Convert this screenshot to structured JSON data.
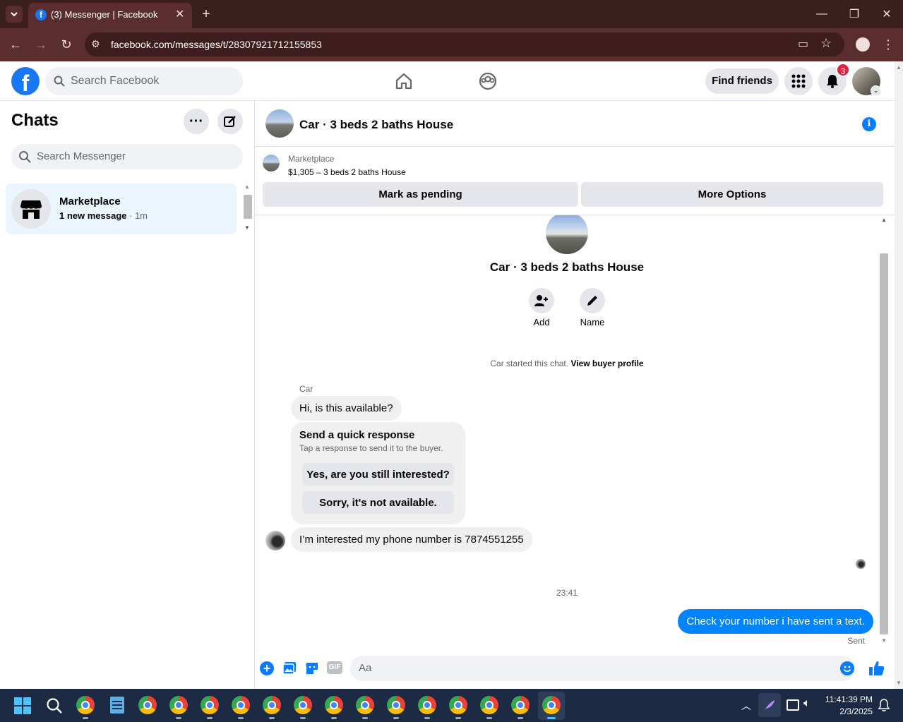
{
  "browser": {
    "tab_title": "(3) Messenger | Facebook",
    "url": "facebook.com/messages/t/28307921712155853",
    "colors": {
      "tabbar": "#3b1f1f",
      "toolbar": "#5a2e2e"
    }
  },
  "header": {
    "search_placeholder": "Search Facebook",
    "find_friends_label": "Find friends",
    "notification_count": "3"
  },
  "sidebar": {
    "title": "Chats",
    "search_placeholder": "Search Messenger",
    "chats": [
      {
        "name": "Marketplace",
        "preview": "1 new message",
        "time": "· 1m"
      }
    ]
  },
  "chat": {
    "title": "Car · 3 beds 2 baths House",
    "listing": {
      "source": "Marketplace",
      "summary": "$1,305 – 3 beds 2 baths House",
      "mark_pending_label": "Mark as pending",
      "more_options_label": "More Options"
    },
    "group_name": "Car · 3 beds 2 baths House",
    "actions": {
      "add_label": "Add",
      "name_label": "Name"
    },
    "started_text": "Car started this chat.",
    "view_profile_label": "View buyer profile",
    "sender_name": "Car",
    "messages": {
      "m1": "Hi, is this available?",
      "quick_title": "Send a quick response",
      "quick_subtitle": "Tap a response to send it to the buyer.",
      "quick_option_1": "Yes, are you still interested?",
      "quick_option_2": "Sorry, it's not available.",
      "m2": "I’m interested my phone number is 7874551255",
      "timestamp": "23:41",
      "sent_message": "Check your number i have sent a text.",
      "sent_status": "Sent"
    },
    "composer": {
      "placeholder": "Aa",
      "gif_label": "GIF"
    },
    "colors": {
      "accent": "#0084ff",
      "brand": "#1877f2",
      "badge": "#e41e3f"
    }
  },
  "taskbar": {
    "time": "11:41:39 PM",
    "date": "2/3/2025"
  }
}
